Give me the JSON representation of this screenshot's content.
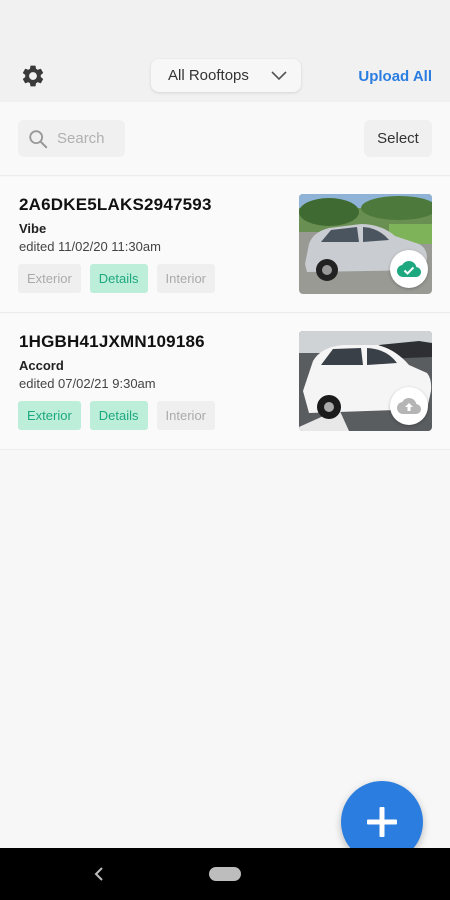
{
  "header": {
    "rooftop_selected": "All Rooftops",
    "upload_all_label": "Upload All"
  },
  "search": {
    "placeholder": "Search",
    "select_label": "Select"
  },
  "vehicles": [
    {
      "vin": "2A6DKE5LAKS2947593",
      "model": "Vibe",
      "edited": "edited 11/02/20 11:30am",
      "tags": [
        {
          "label": "Exterior",
          "active": false
        },
        {
          "label": "Details",
          "active": true
        },
        {
          "label": "Interior",
          "active": false
        }
      ],
      "upload_status": "uploaded",
      "status_icon": "cloud-check-icon"
    },
    {
      "vin": "1HGBH41JXMN109186",
      "model": "Accord",
      "edited": "edited 07/02/21 9:30am",
      "tags": [
        {
          "label": "Exterior",
          "active": true
        },
        {
          "label": "Details",
          "active": true
        },
        {
          "label": "Interior",
          "active": false
        }
      ],
      "upload_status": "pending",
      "status_icon": "cloud-upload-icon"
    }
  ],
  "colors": {
    "accent": "#2b7de0",
    "tag_active_bg": "#bdeed9",
    "tag_active_text": "#1ea880",
    "uploaded_icon": "#1ea880",
    "pending_icon": "#b5b5b5"
  }
}
